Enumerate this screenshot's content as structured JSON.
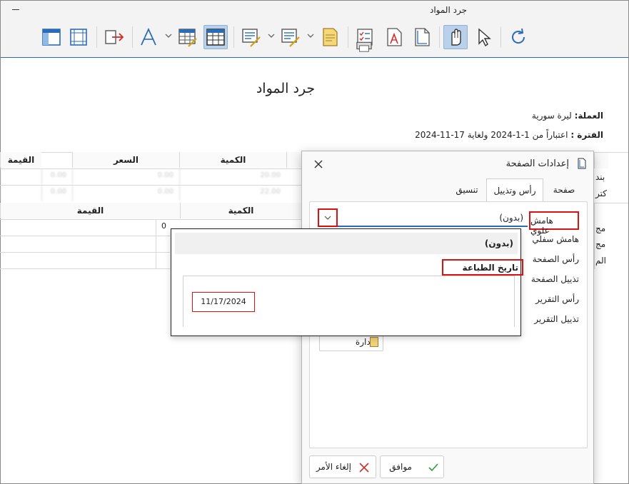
{
  "window": {
    "title": "جرد المواد"
  },
  "toolbar": {
    "icons": [
      "page-layout-icon",
      "margins-icon",
      "export-icon",
      "font-icon",
      "table-edit-icon",
      "table-grid-icon",
      "edit-report-icon",
      "edit-filter-icon",
      "header-page-icon",
      "checklist-icon",
      "print-icon",
      "pdf-icon",
      "page-icon",
      "hand-icon",
      "pointer-icon",
      "refresh-icon"
    ]
  },
  "report": {
    "title": "جرد المواد",
    "currency_label": "العملة:",
    "currency_value": "ليرة سورية",
    "period_label": "الفترة :",
    "period_value": "اعتباراً من 1-1-2024 ولغاية 17-11-2024",
    "top_table": {
      "headers": [
        "القيمة",
        "السعر",
        "الكمية"
      ],
      "rows": [
        {
          "name": "بند",
          "values": [
            "",
            "0.00",
            "20.00",
            "0.00"
          ]
        },
        {
          "name": "كتر",
          "values": [
            "",
            "0.00",
            "22.00",
            "0.00"
          ]
        }
      ]
    },
    "bottom_table": {
      "headers": [
        "القيمة",
        "الكمية"
      ],
      "zero": "0",
      "row_names": [
        "مج",
        "مج",
        "الم"
      ]
    }
  },
  "dialog": {
    "title": "إعدادات الصفحة",
    "tabs": [
      {
        "label": "صفحة",
        "selected": false
      },
      {
        "label": "رأس وتذييل",
        "selected": true
      },
      {
        "label": "تنسيق",
        "selected": false
      }
    ],
    "side_items": [
      "هامش علوي",
      "هامش سفلي",
      "رأس الصفحة",
      "تذييل الصفحة",
      "رأس التقرير",
      "تذييل التقرير"
    ],
    "select_value": "(بدون)",
    "manage_label": "إدارة",
    "ok_label": "موافق",
    "cancel_label": "إلغاء الأمر"
  },
  "dropdown": {
    "options": [
      "(بدون)",
      "تاريخ الطباعة"
    ],
    "preview_date": "11/17/2024"
  },
  "colors": {
    "accent": "#2b6cb8",
    "highlight": "#dd1111",
    "ok_check": "#2e9a3a",
    "cancel_x": "#d62828"
  }
}
